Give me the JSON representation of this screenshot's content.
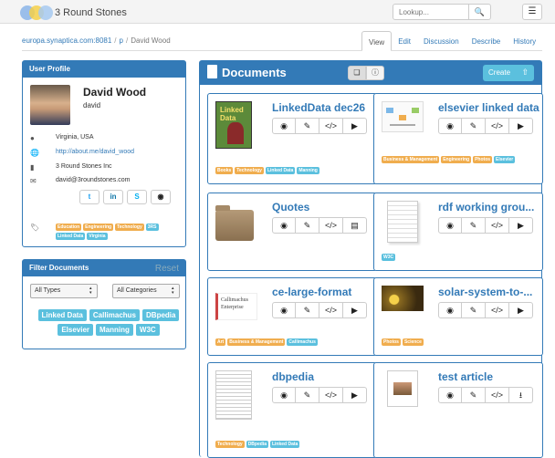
{
  "app": {
    "brand": "3 Round Stones",
    "logo_colors": [
      "#8ab4e8",
      "#f5d04a",
      "#a6c9f0"
    ]
  },
  "header": {
    "lookup_placeholder": "Lookup...",
    "search_icon": "search-icon",
    "menu_icon": "hamburger-menu-icon"
  },
  "breadcrumb": {
    "host": "europa.synaptica.com:8081",
    "p": "p",
    "current": "David Wood"
  },
  "tabs": [
    {
      "label": "View",
      "active": true
    },
    {
      "label": "Edit"
    },
    {
      "label": "Discussion"
    },
    {
      "label": "Describe"
    },
    {
      "label": "History"
    }
  ],
  "profile": {
    "heading": "User Profile",
    "name": "David Wood",
    "username": "david",
    "location": "Virginia, USA",
    "url": "http://about.me/david_wood",
    "company": "3 Round Stones Inc",
    "email": "david@3roundstones.com",
    "tags": [
      {
        "label": "Education",
        "color": "o"
      },
      {
        "label": "Engineering",
        "color": "o"
      },
      {
        "label": "Technology",
        "color": "o"
      },
      {
        "label": "3RS",
        "color": "b"
      },
      {
        "label": "Linked Data",
        "color": "b"
      },
      {
        "label": "Virginia",
        "color": "b"
      }
    ],
    "social_colors": {
      "twitter": "#1da1f2",
      "linkedin": "#0e76a8",
      "skype": "#00aff0",
      "github": "#222222"
    }
  },
  "filter": {
    "heading": "Filter Documents",
    "reset": "Reset",
    "type_select": "All Types",
    "category_select": "All Categories",
    "buttons": [
      "Linked Data",
      "Callimachus",
      "DBpedia",
      "Elsevier",
      "Manning",
      "W3C"
    ]
  },
  "documents": {
    "heading": "Documents",
    "create_label": "Create",
    "cards": [
      {
        "title": "LinkedData dec26",
        "thumb": "book-cover",
        "actions": [
          "eye-icon",
          "pencil-icon",
          "code-icon",
          "play-icon"
        ],
        "tags": [
          {
            "label": "Books",
            "color": "o"
          },
          {
            "label": "Technology",
            "color": "o"
          },
          {
            "label": "Linked Data",
            "color": "b"
          },
          {
            "label": "Manning",
            "color": "b"
          }
        ]
      },
      {
        "title": "elsevier linked data",
        "thumb": "diagram",
        "actions": [
          "eye-icon",
          "pencil-icon",
          "code-icon",
          "play-icon"
        ],
        "tags": [
          {
            "label": "Business & Management",
            "color": "o"
          },
          {
            "label": "Engineering",
            "color": "o"
          },
          {
            "label": "Photos",
            "color": "o"
          },
          {
            "label": "Elsevier",
            "color": "b"
          }
        ]
      },
      {
        "title": "Quotes",
        "thumb": "folder",
        "actions": [
          "eye-icon",
          "pencil-icon",
          "code-icon",
          "archive-icon"
        ],
        "tags": []
      },
      {
        "title": "rdf working grou...",
        "thumb": "document",
        "actions": [
          "eye-icon",
          "pencil-icon",
          "code-icon",
          "play-icon"
        ],
        "tags": [
          {
            "label": "W3C",
            "color": "b"
          }
        ]
      },
      {
        "title": "ce-large-format",
        "thumb": "callimachus-logo",
        "thumb_text": "Callimachus Enterprise",
        "actions": [
          "eye-icon",
          "pencil-icon",
          "code-icon",
          "play-icon"
        ],
        "tags": [
          {
            "label": "Art",
            "color": "o"
          },
          {
            "label": "Business & Management",
            "color": "o"
          },
          {
            "label": "Callimachus",
            "color": "b"
          }
        ]
      },
      {
        "title": "solar-system-to-...",
        "thumb": "solar-photo",
        "actions": [
          "eye-icon",
          "pencil-icon",
          "code-icon",
          "play-icon"
        ],
        "tags": [
          {
            "label": "Photos",
            "color": "o"
          },
          {
            "label": "Science",
            "color": "o"
          }
        ]
      },
      {
        "title": "dbpedia",
        "thumb": "paper",
        "actions": [
          "eye-icon",
          "pencil-icon",
          "code-icon",
          "play-icon"
        ],
        "tags": [
          {
            "label": "Technology",
            "color": "o"
          },
          {
            "label": "DBpedia",
            "color": "b"
          },
          {
            "label": "Linked Data",
            "color": "b"
          }
        ]
      },
      {
        "title": "test article",
        "thumb": "article",
        "actions": [
          "eye-icon",
          "pencil-icon",
          "code-icon",
          "download-icon"
        ],
        "tags": []
      }
    ]
  }
}
